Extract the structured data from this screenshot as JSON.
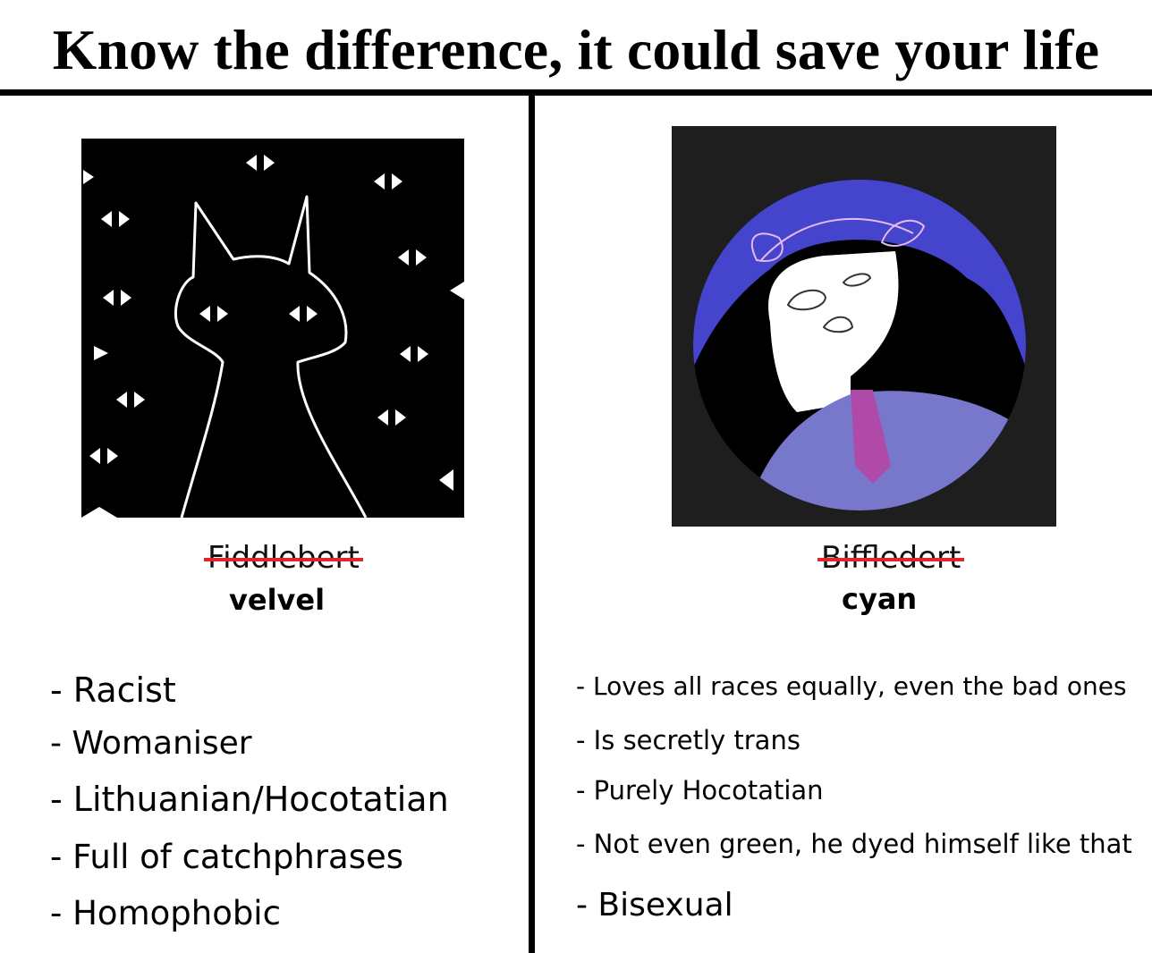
{
  "title": "Know the difference, it could save your life",
  "left": {
    "old_name": "Fiddlebert",
    "new_name": "velvel",
    "traits": [
      "- Racist",
      "- Womaniser",
      "- Lithuanian/Hocotatian",
      "- Full of catchphrases",
      "- Homophobic"
    ]
  },
  "right": {
    "old_name": "Biffledert",
    "new_name": "cyan",
    "traits": [
      "- Loves all races equally, even the bad ones",
      "- Is secretly trans",
      "- Purely Hocotatian",
      "- Not even green, he dyed himself like that",
      "- Bisexual"
    ]
  },
  "colors": {
    "strike": "#e0262b",
    "hair": "#4444cc",
    "shirt": "#7777cc",
    "tie": "#b04aa8"
  }
}
